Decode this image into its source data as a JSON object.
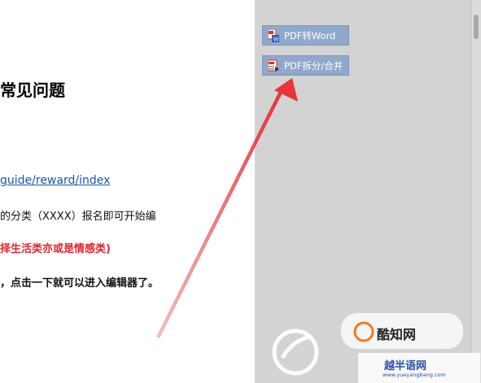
{
  "document": {
    "title": "常见问题",
    "link": "guide/reward/index",
    "line1": "的分类（XXXX）报名即可开始编",
    "line2": "择生活类亦或是情感类)",
    "line3": "，点击一下就可以进入编辑器了。"
  },
  "tools": {
    "pdf_to_word": "PDF转Word",
    "pdf_split_merge": "PDF拆分/合并"
  },
  "watermark": {
    "brand": "酷知网",
    "site_name": "越半语网",
    "site_url": "www.yueyangbang.com"
  },
  "colors": {
    "panel": "#d3d3d3",
    "button": "#90a8cc",
    "arrow": "#e8343a",
    "link": "#1a55a8"
  }
}
